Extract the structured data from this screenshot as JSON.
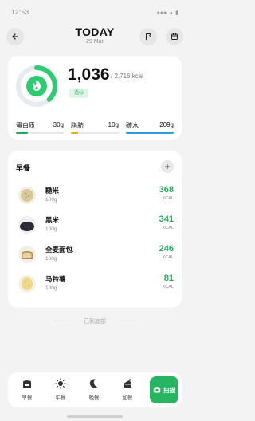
{
  "status": {
    "time": "12:53",
    "icons": "●●● ▲ ▮"
  },
  "header": {
    "title": "TODAY",
    "date": "29 Mar"
  },
  "summary": {
    "consumed": "1,036",
    "goal_text": "/ 2,716 kcal",
    "tag": "适标",
    "progress": 0.38,
    "colors": {
      "ring": "#2ecc71",
      "track": "#e7ebf0"
    },
    "macros": [
      {
        "name": "蛋白质",
        "value": "30g",
        "fill": 0.25,
        "color": "#2aa45c"
      },
      {
        "name": "脂肪",
        "value": "10g",
        "fill": 0.15,
        "color": "#f5a623"
      },
      {
        "name": "碳水",
        "value": "209g",
        "fill": 1.0,
        "color": "#2f9be0"
      }
    ]
  },
  "meal": {
    "title": "早餐",
    "add_label": "+",
    "foods": [
      {
        "name": "糙米",
        "qty": "100g",
        "kcal": "368",
        "unit": "KCAL",
        "icon": "brown-rice"
      },
      {
        "name": "黑米",
        "qty": "100g",
        "kcal": "341",
        "unit": "KCAL",
        "icon": "black-rice"
      },
      {
        "name": "全麦面包",
        "qty": "100g",
        "kcal": "246",
        "unit": "KCAL",
        "icon": "bread"
      },
      {
        "name": "马铃薯",
        "qty": "100g",
        "kcal": "81",
        "unit": "KCAL",
        "icon": "potato"
      }
    ]
  },
  "end_note": "已到底部",
  "nav": [
    {
      "label": "早餐",
      "icon": "breakfast-icon"
    },
    {
      "label": "午餐",
      "icon": "sun-icon"
    },
    {
      "label": "晚餐",
      "icon": "moon-icon"
    },
    {
      "label": "加餐",
      "icon": "snack-icon"
    }
  ],
  "scan": {
    "label": "扫描",
    "icon": "camera-icon"
  }
}
